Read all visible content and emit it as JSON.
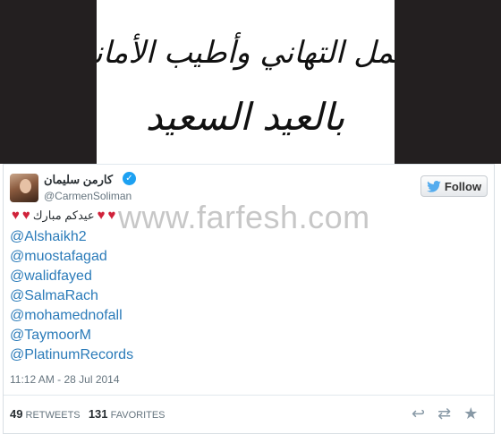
{
  "banner": {
    "line1": "أجمل التهاني وأطيب الأماني",
    "line2": "بالعيد السعيد"
  },
  "profile": {
    "display_name": "كارمن سليمان",
    "handle": "@CarmenSoliman"
  },
  "follow_label": "Follow",
  "tweet": {
    "text": "عيدكم مبارك",
    "mentions": [
      "@Alshaikh2",
      "@muostafagad",
      "@walidfayed",
      "@SalmaRach",
      "@mohamednofall",
      "@TaymoorM",
      "@PlatinumRecords"
    ],
    "timestamp": "11:12 AM - 28 Jul 2014"
  },
  "stats": {
    "retweets_count": "49",
    "retweets_label": "RETWEETS",
    "favorites_count": "131",
    "favorites_label": "FAVORITES"
  },
  "watermark": "www.farfesh.com",
  "colors": {
    "link": "#2b7bb9",
    "verified": "#1da1f2",
    "heart": "#d0223a",
    "banner_bg": "#231f20"
  }
}
